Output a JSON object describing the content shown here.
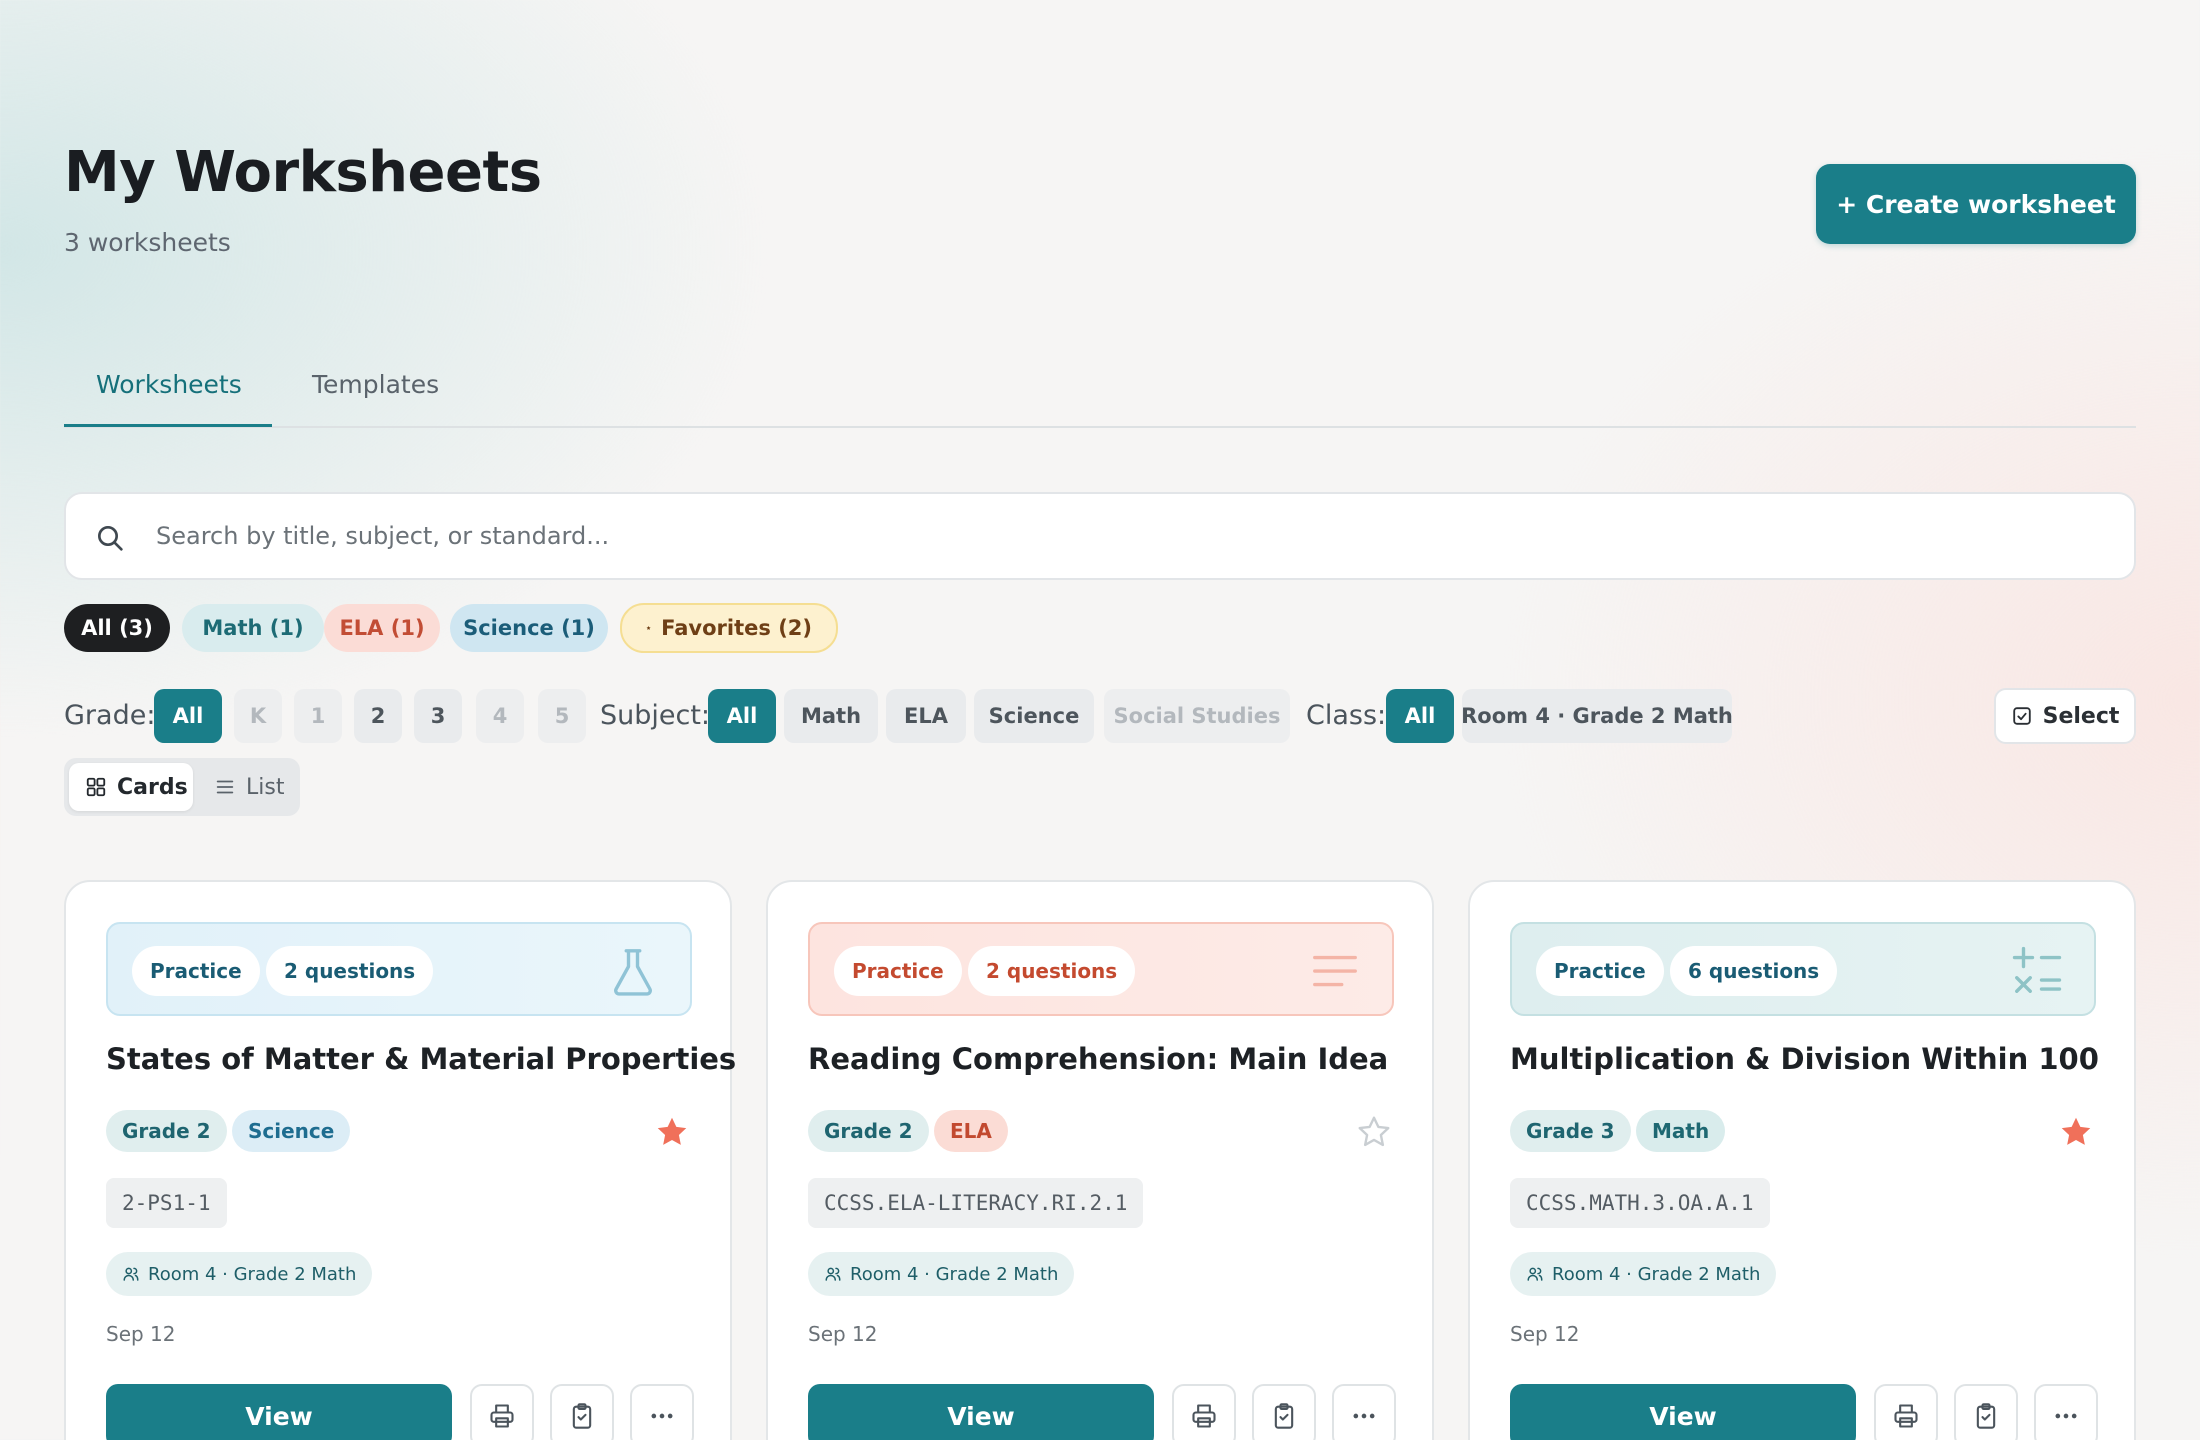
{
  "header": {
    "title": "My Worksheets",
    "count": "3 worksheets",
    "create_label": "+ Create worksheet"
  },
  "tabs": [
    {
      "label": "Worksheets",
      "active": true
    },
    {
      "label": "Templates",
      "active": false
    }
  ],
  "search": {
    "placeholder": "Search by title, subject, or standard...",
    "icon": "search-icon"
  },
  "quick_filters": [
    {
      "label": "All (3)",
      "active": true
    },
    {
      "label": "Math (1)"
    },
    {
      "label": "ELA (1)"
    },
    {
      "label": "Science (1)"
    },
    {
      "label": "Favorites (2)",
      "icon": "star-icon"
    }
  ],
  "grade_filter": {
    "label": "Grade:",
    "options": [
      "All",
      "K",
      "1",
      "2",
      "3",
      "4",
      "5"
    ],
    "selected": "All"
  },
  "subject_filter": {
    "label": "Subject:",
    "options": [
      "All",
      "Math",
      "ELA",
      "Science",
      "Social Studies"
    ],
    "selected": "All"
  },
  "class_filter": {
    "label": "Class:",
    "options": [
      "All",
      "Room 4 · Grade 2 Math"
    ],
    "selected": "All"
  },
  "select_label": "Select",
  "view_toggle": {
    "cards": "Cards",
    "list": "List",
    "selected": "Cards"
  },
  "cards": [
    {
      "type": "Practice",
      "questions": "2 questions",
      "icon": "flask-icon",
      "title": "States of Matter & Material Properties",
      "grade": "Grade 2",
      "subject": "Science",
      "favorite": true,
      "standard": "2-PS1-1",
      "class": "Room 4 · Grade 2 Math",
      "date": "Sep 12",
      "view_label": "View"
    },
    {
      "type": "Practice",
      "questions": "2 questions",
      "icon": "text-lines-icon",
      "title": "Reading Comprehension: Main Idea",
      "grade": "Grade 2",
      "subject": "ELA",
      "favorite": false,
      "standard": "CCSS.ELA-LITERACY.RI.2.1",
      "class": "Room 4 · Grade 2 Math",
      "date": "Sep 12",
      "view_label": "View"
    },
    {
      "type": "Practice",
      "questions": "6 questions",
      "icon": "math-operators-icon",
      "title": "Multiplication & Division Within 100",
      "grade": "Grade 3",
      "subject": "Math",
      "favorite": true,
      "standard": "CCSS.MATH.3.OA.A.1",
      "class": "Room 4 · Grade 2 Math",
      "date": "Sep 12",
      "view_label": "View"
    }
  ],
  "colors": {
    "accent": "#1a7e89",
    "star": "#f0705a"
  }
}
